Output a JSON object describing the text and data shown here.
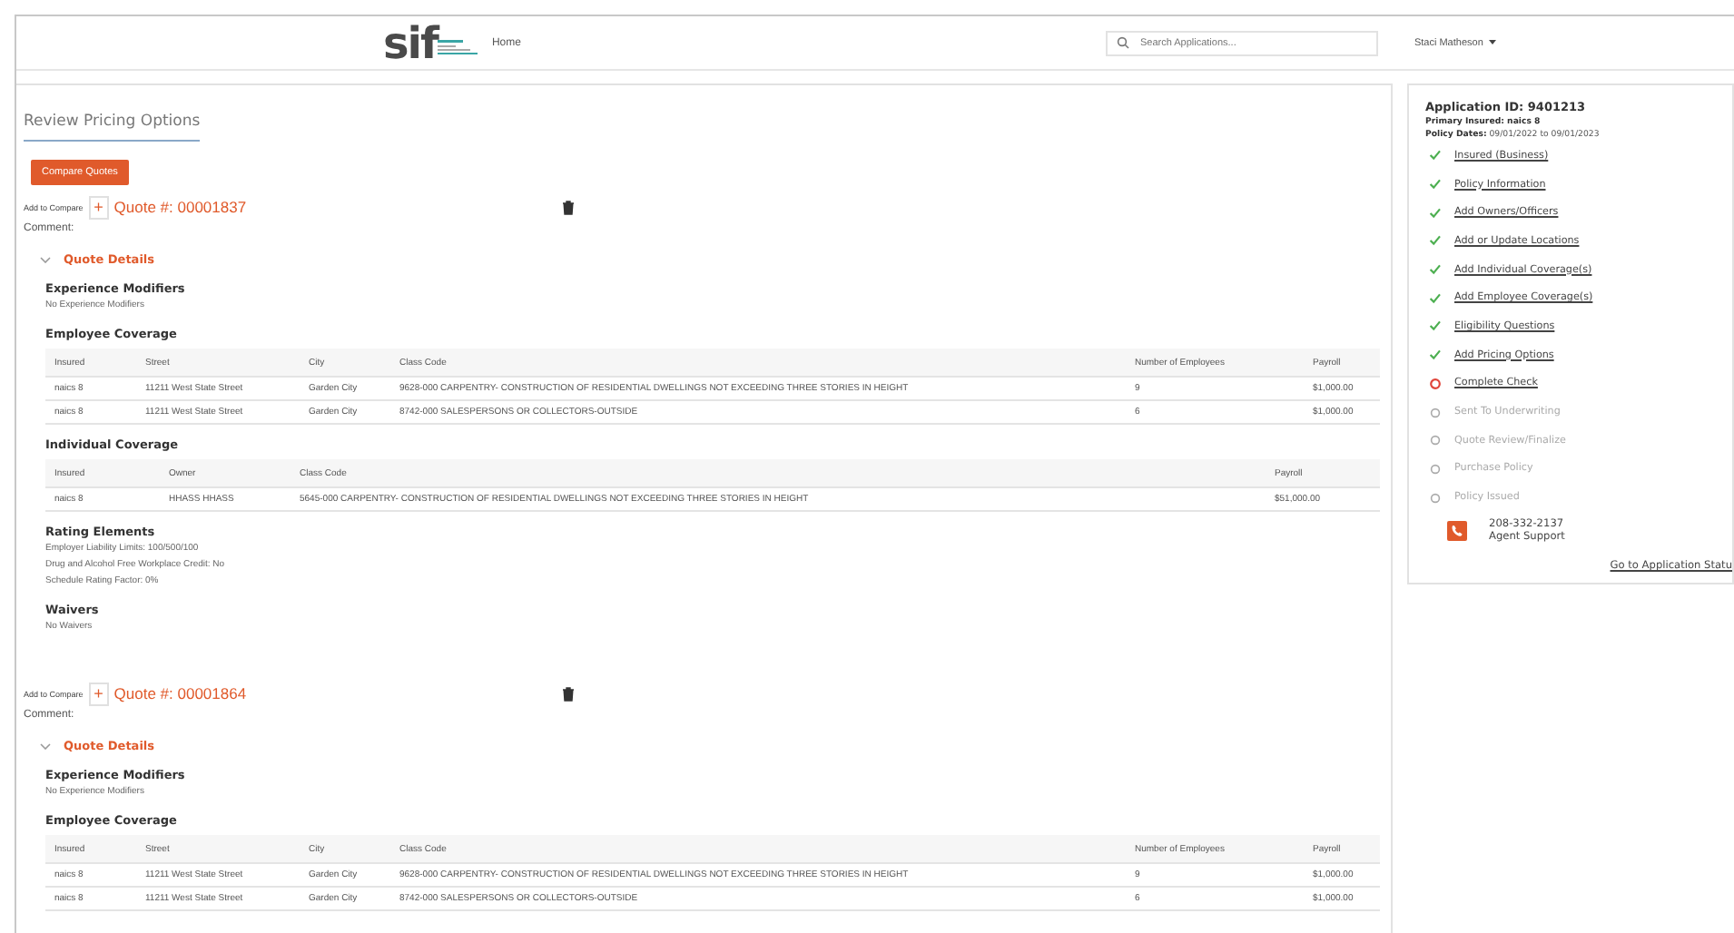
{
  "header": {
    "logo": "sif",
    "nav": [
      {
        "label": "Home"
      }
    ],
    "search": {
      "placeholder": "Search Applications..."
    },
    "user": "Staci Matheson"
  },
  "page": {
    "title": "Review Pricing Options",
    "compare_button": "Compare Quotes"
  },
  "quotes": [
    {
      "add_label": "Add to Compare",
      "add_symbol": "+",
      "quote_number": "Quote #: 00001837",
      "comment_label": "Comment:",
      "details": {
        "label": "Quote Details",
        "expanded": true
      },
      "sections": [
        {
          "kind": "text",
          "title": "Experience Modifiers",
          "lines": [
            "No Experience Modifiers"
          ]
        },
        {
          "kind": "employee",
          "title": "Employee Coverage",
          "columns": [
            "Insured",
            "Street",
            "City",
            "Class Code",
            "Number of Employees",
            "Payroll"
          ],
          "rows": [
            [
              "naics 8",
              "11211 West State Street",
              "Garden City",
              "9628-000 CARPENTRY- CONSTRUCTION OF RESIDENTIAL DWELLINGS NOT EXCEEDING THREE STORIES IN HEIGHT",
              "9",
              "$1,000.00"
            ],
            [
              "naics 8",
              "11211 West State Street",
              "Garden City",
              "8742-000 SALESPERSONS OR COLLECTORS-OUTSIDE",
              "6",
              "$1,000.00"
            ]
          ]
        },
        {
          "kind": "individual",
          "title": "Individual Coverage",
          "columns": [
            "Insured",
            "Owner",
            "Class Code",
            "Payroll"
          ],
          "rows": [
            [
              "naics 8",
              "HHASS HHASS",
              "5645-000 CARPENTRY- CONSTRUCTION OF RESIDENTIAL DWELLINGS NOT EXCEEDING THREE STORIES IN HEIGHT",
              "$51,000.00"
            ]
          ]
        },
        {
          "kind": "text",
          "title": "Rating Elements",
          "lines": [
            "Employer Liability Limits: 100/500/100",
            "Drug and Alcohol Free Workplace Credit: No",
            "Schedule Rating Factor: 0%"
          ]
        },
        {
          "kind": "text",
          "title": "Waivers",
          "lines": [
            "No Waivers"
          ]
        }
      ]
    },
    {
      "add_label": "Add to Compare",
      "add_symbol": "+",
      "quote_number": "Quote #: 00001864",
      "comment_label": "Comment:",
      "details": {
        "label": "Quote Details",
        "expanded": true
      },
      "sections": [
        {
          "kind": "text",
          "title": "Experience Modifiers",
          "lines": [
            "No Experience Modifiers"
          ]
        },
        {
          "kind": "employee",
          "title": "Employee Coverage",
          "columns": [
            "Insured",
            "Street",
            "City",
            "Class Code",
            "Number of Employees",
            "Payroll"
          ],
          "rows": [
            [
              "naics 8",
              "11211 West State Street",
              "Garden City",
              "9628-000 CARPENTRY- CONSTRUCTION OF RESIDENTIAL DWELLINGS NOT EXCEEDING THREE STORIES IN HEIGHT",
              "9",
              "$1,000.00"
            ],
            [
              "naics 8",
              "11211 West State Street",
              "Garden City",
              "8742-000 SALESPERSONS OR COLLECTORS-OUTSIDE",
              "6",
              "$1,000.00"
            ]
          ]
        }
      ]
    }
  ],
  "sidebar": {
    "application_id": "Application ID: 9401213",
    "primary_insured": "Primary Insured: naics 8",
    "policy_dates": "**Policy Dates:** 09/01/2022 to 09/01/2023",
    "steps": [
      {
        "label": "Insured (Business)",
        "kind": "done"
      },
      {
        "label": "Policy Information",
        "kind": "done"
      },
      {
        "label": "Add Owners/Officers",
        "kind": "done"
      },
      {
        "label": "Add or Update Locations",
        "kind": "done"
      },
      {
        "label": "Add Individual Coverage(s)",
        "kind": "done"
      },
      {
        "label": "Add Employee Coverage(s)",
        "kind": "done"
      },
      {
        "label": "Eligibility Questions",
        "kind": "done"
      },
      {
        "label": "Add Pricing Options",
        "kind": "done"
      },
      {
        "label": "Complete Check",
        "kind": "current"
      },
      {
        "label": "Sent To Underwriting",
        "kind": "pending"
      },
      {
        "label": "Quote Review/Finalize",
        "kind": "pending"
      },
      {
        "label": "Purchase Policy",
        "kind": "pending"
      },
      {
        "label": "Policy Issued",
        "kind": "pending"
      }
    ],
    "phone": "208-332-2137",
    "support_label": "Agent Support",
    "status_link": "Go to Application Statu"
  }
}
